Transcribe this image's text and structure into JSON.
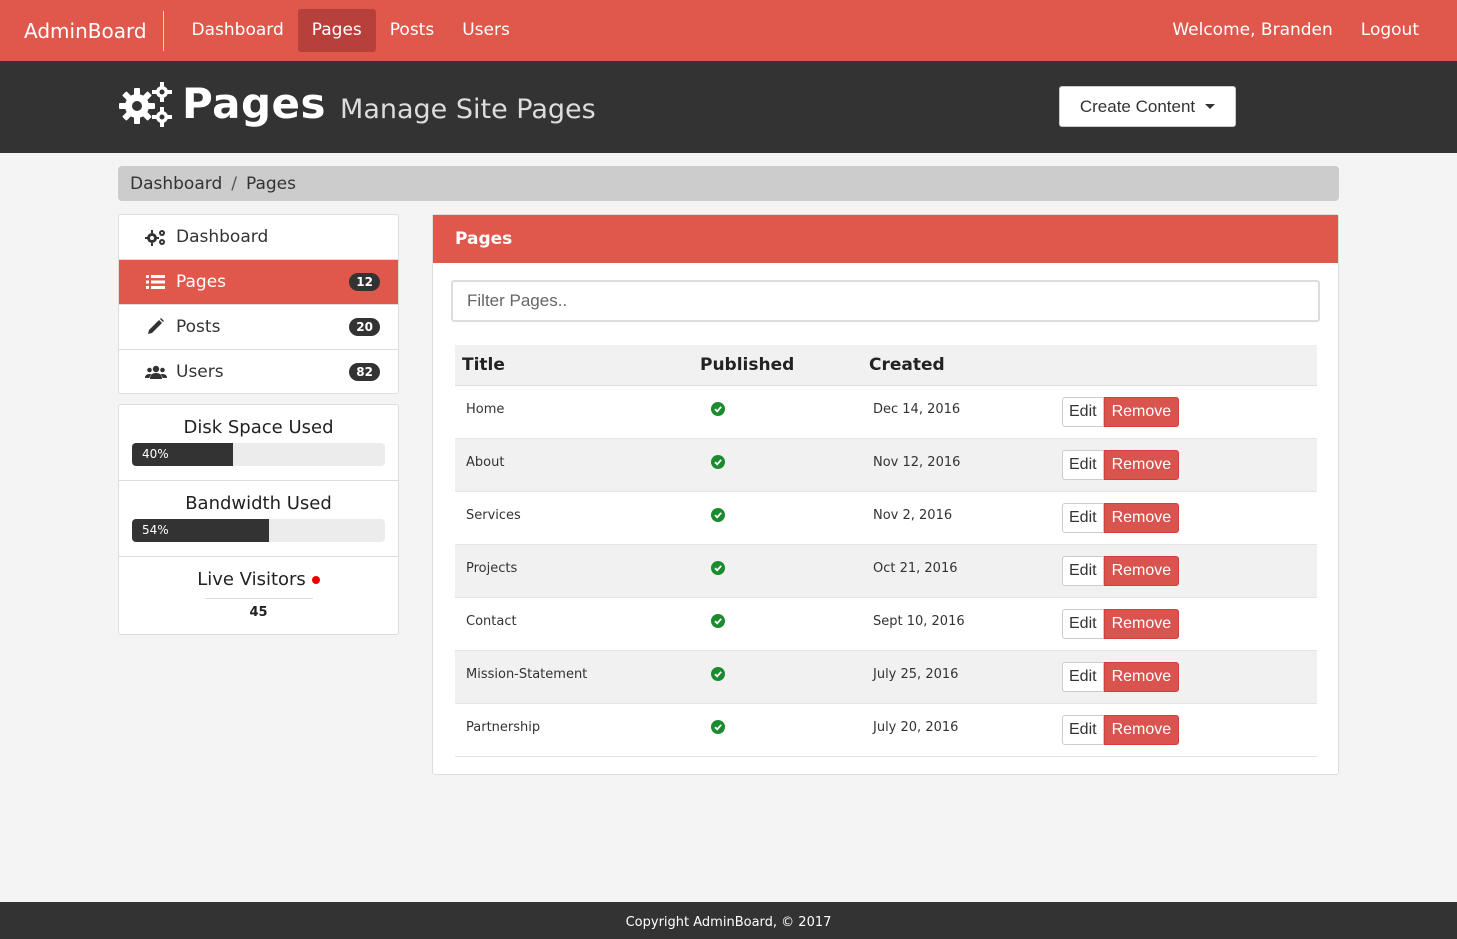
{
  "navbar": {
    "brand": "AdminBoard",
    "links": [
      {
        "label": "Dashboard",
        "active": false
      },
      {
        "label": "Pages",
        "active": true
      },
      {
        "label": "Posts",
        "active": false
      },
      {
        "label": "Users",
        "active": false
      }
    ],
    "welcome": "Welcome, Branden",
    "logout": "Logout"
  },
  "header": {
    "icon": "gears-icon",
    "title": "Pages",
    "subtitle": "Manage Site Pages",
    "create_button": "Create Content"
  },
  "breadcrumb": {
    "items": [
      "Dashboard",
      "Pages"
    ],
    "separator": "/"
  },
  "sidebar": {
    "items": [
      {
        "label": "Dashboard",
        "icon": "gears-icon",
        "badge": ""
      },
      {
        "label": "Pages",
        "icon": "list-icon",
        "badge": "12",
        "active": true
      },
      {
        "label": "Posts",
        "icon": "pencil-icon",
        "badge": "20"
      },
      {
        "label": "Users",
        "icon": "users-icon",
        "badge": "82"
      }
    ],
    "disk": {
      "title": "Disk Space Used",
      "label": "40%",
      "value": 40
    },
    "bandwidth": {
      "title": "Bandwidth Used",
      "label": "54%",
      "value": 54
    },
    "live": {
      "title": "Live Visitors",
      "count": "45"
    }
  },
  "panel": {
    "heading": "Pages",
    "filter_placeholder": "Filter Pages..",
    "columns": {
      "title": "Title",
      "published": "Published",
      "created": "Created"
    },
    "edit_label": "Edit",
    "remove_label": "Remove",
    "rows": [
      {
        "title": "Home",
        "published": true,
        "created": "Dec 14, 2016"
      },
      {
        "title": "About",
        "published": true,
        "created": "Nov 12, 2016"
      },
      {
        "title": "Services",
        "published": true,
        "created": "Nov 2, 2016"
      },
      {
        "title": "Projects",
        "published": true,
        "created": "Oct 21, 2016"
      },
      {
        "title": "Contact",
        "published": true,
        "created": "Sept 10, 2016"
      },
      {
        "title": "Mission-Statement",
        "published": true,
        "created": "July 25, 2016"
      },
      {
        "title": "Partnership",
        "published": true,
        "created": "July 20, 2016"
      }
    ]
  },
  "footer": {
    "text": "Copyright AdminBoard, © 2017"
  },
  "colors": {
    "brand_red": "#e0574c",
    "dark": "#333333",
    "active_nav": "#b8403a",
    "success": "#1a8c2f",
    "danger": "#d9534f",
    "live_dot": "#ee0000"
  }
}
